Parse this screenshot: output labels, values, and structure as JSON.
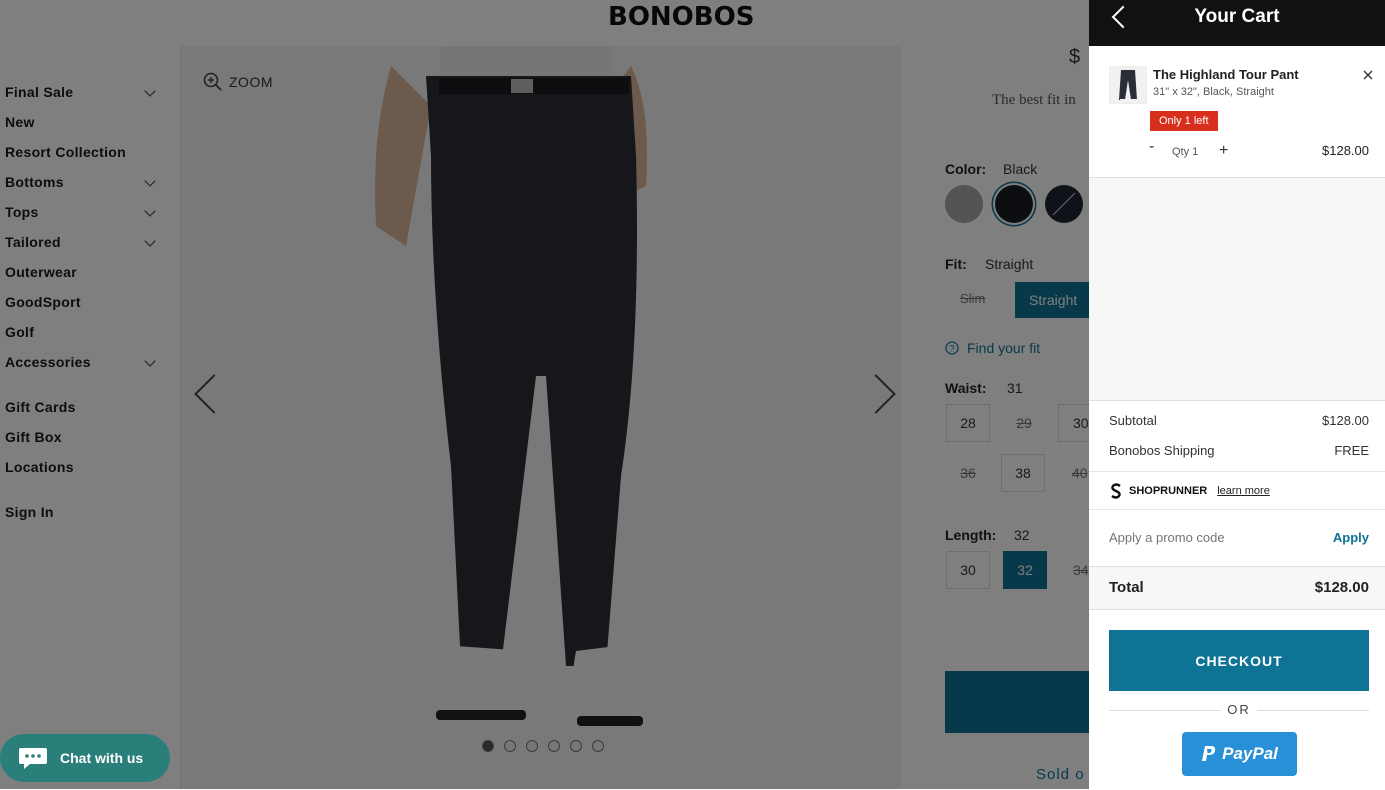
{
  "header": {
    "logo": "BONOBOS"
  },
  "sidebar": {
    "items": [
      {
        "label": "Final Sale",
        "has_dropdown": true
      },
      {
        "label": "New",
        "has_dropdown": false
      },
      {
        "label": "Resort Collection",
        "has_dropdown": false
      },
      {
        "label": "Bottoms",
        "has_dropdown": true
      },
      {
        "label": "Tops",
        "has_dropdown": true
      },
      {
        "label": "Tailored",
        "has_dropdown": true
      },
      {
        "label": "Outerwear",
        "has_dropdown": false
      },
      {
        "label": "GoodSport",
        "has_dropdown": false
      },
      {
        "label": "Golf",
        "has_dropdown": false
      },
      {
        "label": "Accessories",
        "has_dropdown": true
      },
      {
        "label": "Gift Cards",
        "has_dropdown": false
      },
      {
        "label": "Gift Box",
        "has_dropdown": false
      },
      {
        "label": "Locations",
        "has_dropdown": false
      },
      {
        "label": "Sign In",
        "has_dropdown": false
      }
    ]
  },
  "gallery": {
    "zoom_label": "ZOOM",
    "dots": 6,
    "active_dot": 1
  },
  "product": {
    "price_partial": "$",
    "tagline": "The best fit in",
    "color_label": "Color:",
    "color_value": "Black",
    "swatches": [
      "#9a9a9a",
      "#1b1d23",
      "#1f2530"
    ],
    "fit_label": "Fit:",
    "fit_value": "Straight",
    "fit_options": [
      "Slim",
      "Straight"
    ],
    "find_fit": "Find your fit",
    "waist_label": "Waist:",
    "waist_value": "31",
    "waist_sizes_row1": [
      "28",
      "29",
      "30"
    ],
    "waist_sizes_row2": [
      "36",
      "38",
      "40"
    ],
    "length_label": "Length:",
    "length_value": "32",
    "length_sizes": [
      "30",
      "32",
      "34"
    ],
    "sold_out_partial": "Sold o"
  },
  "chat": {
    "label": "Chat with us"
  },
  "cart": {
    "title": "Your Cart",
    "item": {
      "name": "The Highland Tour Pant",
      "desc": "31\" x 32\", Black, Straight",
      "badge": "Only 1 left",
      "minus": "-",
      "qty": "Qty 1",
      "plus": "+",
      "price": "$128.00"
    },
    "subtotal_label": "Subtotal",
    "subtotal_value": "$128.00",
    "shipping_label": "Bonobos Shipping",
    "shipping_value": "FREE",
    "shoprunner_brand": "SHOPRUNNER",
    "shoprunner_link": "learn more",
    "promo_placeholder": "Apply a promo code",
    "promo_apply": "Apply",
    "total_label": "Total",
    "total_value": "$128.00",
    "checkout_label": "CHECKOUT",
    "or_label": "OR",
    "paypal_label": "PayPal",
    "accent_color": "#0e7394",
    "badge_color": "#d82f1d"
  }
}
